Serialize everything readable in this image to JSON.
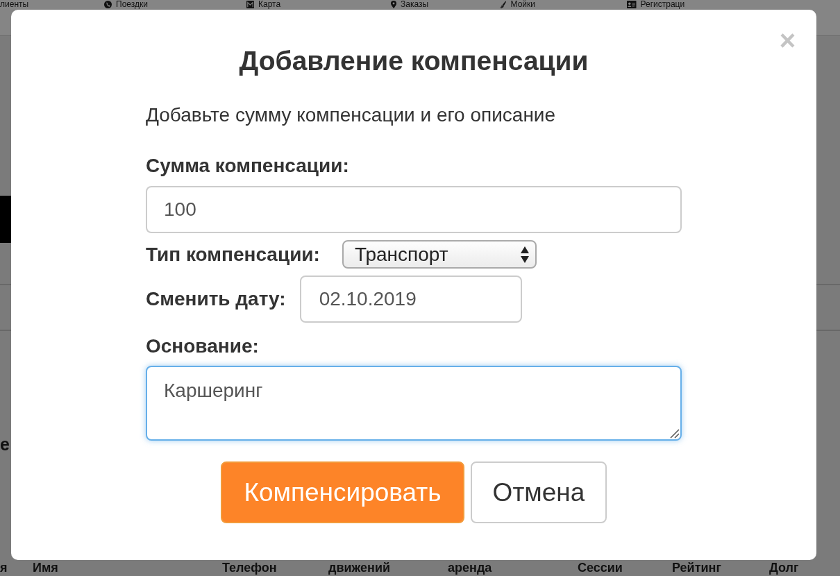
{
  "background": {
    "nav_items": [
      {
        "label": "лиенты"
      },
      {
        "label": "Поездки"
      },
      {
        "label": "Карта"
      },
      {
        "label": "Заказы"
      },
      {
        "label": "Мойки"
      },
      {
        "label": "Регистраци"
      }
    ],
    "text_fragment": "е",
    "table_columns": [
      "я",
      "Имя",
      "Телефон",
      "движений",
      "аренда",
      "Сессии",
      "Рейтинг",
      "Долг"
    ]
  },
  "dialog": {
    "title": "Добавление компенсации",
    "close": "×",
    "description": "Добавьте сумму компенсации и его описание",
    "fields": [
      {
        "kind": "text",
        "label": "Сумма компенсации:",
        "value": "100",
        "focused": false
      },
      {
        "kind": "select",
        "label": "Тип компенсации:",
        "value": "Транспорт",
        "focused": false
      },
      {
        "kind": "date",
        "label": "Сменить дату:",
        "value": "02.10.2019",
        "focused": false
      },
      {
        "kind": "textarea",
        "label": "Основание:",
        "value": "Каршеринг",
        "focused": true
      }
    ],
    "buttons": [
      {
        "kind": "primary",
        "label": "Компенсировать"
      },
      {
        "kind": "default",
        "label": "Отмена"
      }
    ]
  }
}
